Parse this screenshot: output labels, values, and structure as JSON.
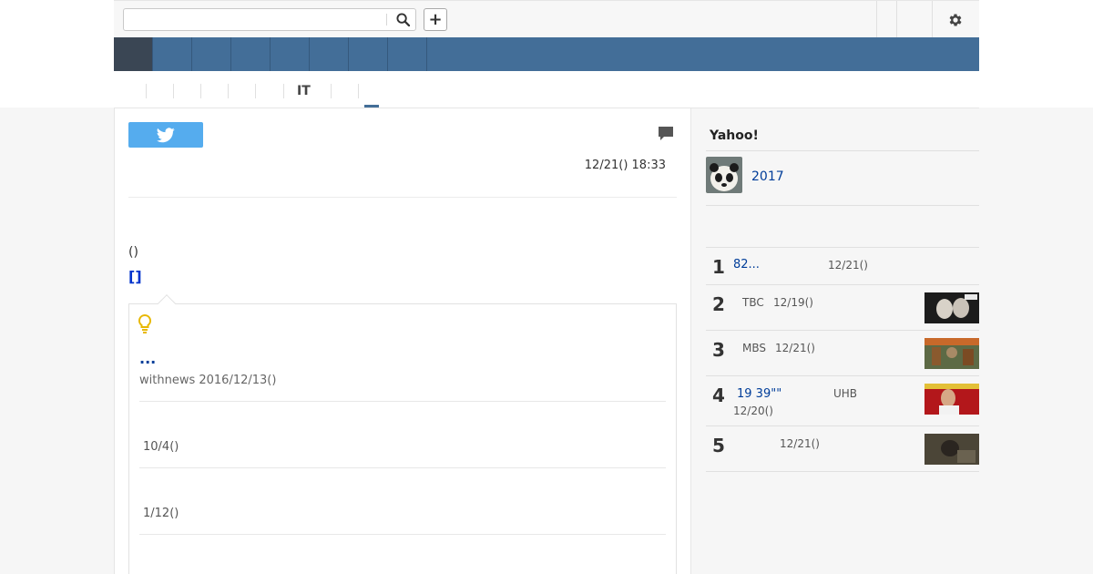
{
  "search": {
    "placeholder": "",
    "value": ""
  },
  "icons": {
    "search": "search-icon",
    "add": "plus-icon",
    "settings": "gear-icon",
    "twitter": "twitter-bird-icon",
    "comment": "comment-icon",
    "bulb": "lightbulb-icon"
  },
  "toolbar": {
    "add_label": "+"
  },
  "colors": {
    "nav_blue": "#436e98",
    "nav_active": "#3a4654",
    "twitter_blue": "#55acee",
    "link_blue": "#003d99"
  },
  "subtabs": [
    {
      "label": ""
    },
    {
      "label": ""
    },
    {
      "label": ""
    },
    {
      "label": ""
    },
    {
      "label": ""
    },
    {
      "label": "IT"
    },
    {
      "label": ""
    },
    {
      "label": ""
    }
  ],
  "article": {
    "date": "12/21() 18:33",
    "paren_text": "()",
    "bracket_link": "[]"
  },
  "related": {
    "title": "...",
    "source": "withnews 2016/12/13()",
    "items": [
      {
        "date": "10/4()"
      },
      {
        "date": "1/12()"
      }
    ]
  },
  "sidebar": {
    "heading": "Yahoo!",
    "feature_label": "2017",
    "ranking": [
      {
        "rank": "1",
        "title": "82...",
        "source": "",
        "date": "12/21()"
      },
      {
        "rank": "2",
        "title": "",
        "source": "TBC",
        "date": "12/19()"
      },
      {
        "rank": "3",
        "title": "",
        "source": "MBS",
        "date": "12/21()"
      },
      {
        "rank": "4",
        "title": "19 39\"\"",
        "source": "UHB",
        "date": "12/20()"
      },
      {
        "rank": "5",
        "title": "",
        "source": "",
        "date": "12/21()"
      }
    ]
  }
}
